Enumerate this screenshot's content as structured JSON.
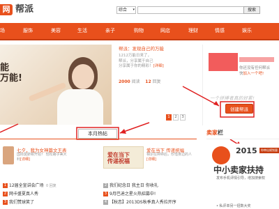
{
  "header": {
    "logo_mark": "网",
    "logo_text": "帮派",
    "search": {
      "scope": "综合",
      "placeholder": "",
      "button": "搜索"
    }
  },
  "nav": [
    "场",
    "服饰",
    "美容",
    "生活",
    "亲子",
    "购物",
    "网店",
    "理财",
    "情感",
    "娱乐"
  ],
  "hero": {
    "overlay_text": "万能!",
    "overlay_text2": "能"
  },
  "blog": {
    "title": "帮派：发现自己的万能",
    "desc_prefix": "1212万能日来了，",
    "desc_line2": "帮派，分享属于自己",
    "desc_line3": "分享属于你的精彩！",
    "more": "[详细]",
    "reads_value": "2000",
    "reads_label": "阅读",
    "replies_value": "12",
    "replies_label": "回复"
  },
  "pager": [
    "1",
    "2",
    "3"
  ],
  "sidebar": {
    "line1": "你还没有任何帮派",
    "line2_prefix": "快",
    "line2_link": "加入一个吧!",
    "slogan": "一个拼搏者真的好累!",
    "create_button": "创建帮派"
  },
  "section": {
    "tab_label": "本月热帖"
  },
  "featured": [
    {
      "title": "七夕，我为女神篇文王表",
      "desc1": "国际莫斯顿开始？ 轻松路乎美大",
      "desc2": "利",
      "more": "[详细]"
    },
    {
      "title": "爱在当下 传递祝福",
      "desc1": "相识在婷婷后，珍惜身边的人",
      "more": "[详细]",
      "thumb_text1": "爱在当下",
      "thumb_text2": "传递祝福"
    }
  ],
  "hot_list_left": [
    {
      "rank": "1",
      "text": "12届全宣讲会广场",
      "count": "0 回复"
    },
    {
      "rank": "2",
      "text": "网卡盛夏真人秀",
      "count": ""
    },
    {
      "rank": "3",
      "text": "我们赞球笑了",
      "count": ""
    }
  ],
  "hot_list_right": [
    {
      "rank": "2",
      "text": "我们纪念日 我主日 你收礼",
      "count": ""
    },
    {
      "rank": "3",
      "text": "9月巴迪之星火热招募中!",
      "count": ""
    },
    {
      "rank": "4",
      "text": "【秋恋】2013DS秋季真人秀拉开序",
      "count": ""
    }
  ],
  "ad": {
    "title_highlight": "卖家",
    "title_rest": "栏",
    "year": "2015",
    "badge": "你审出规划量",
    "headline": "中小卖家扶持",
    "subline": "发布手机评情引导，增加搜索权",
    "footer": "• 私评单另一招数大奖"
  }
}
